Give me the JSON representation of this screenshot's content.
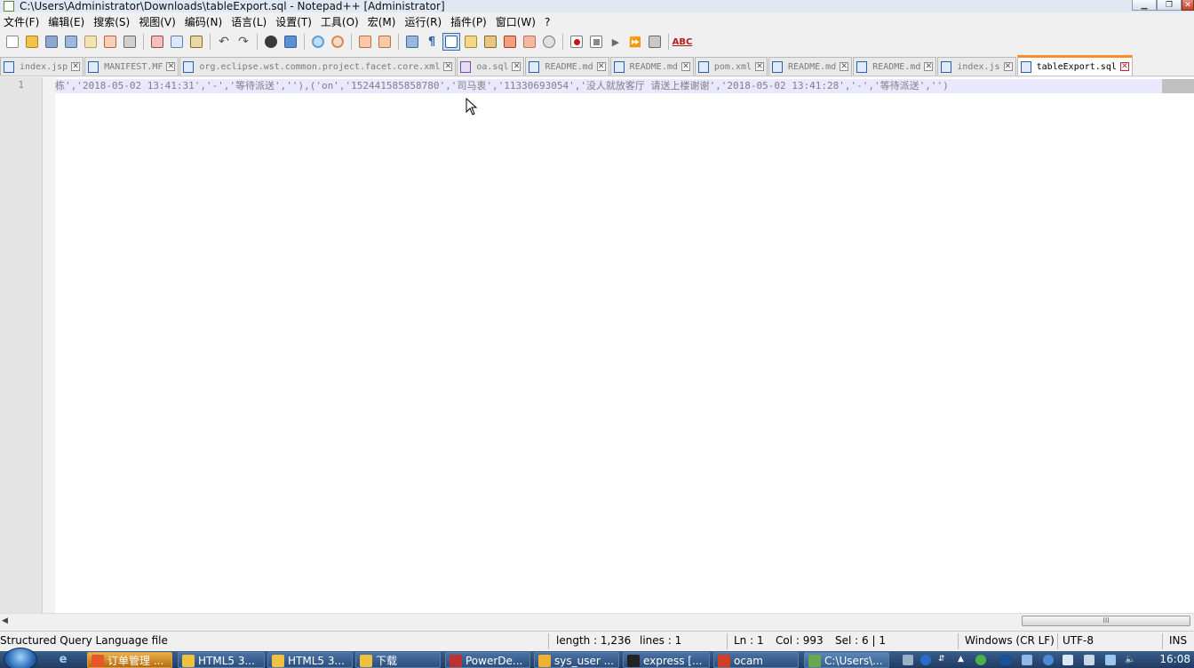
{
  "window": {
    "title": "C:\\Users\\Administrator\\Downloads\\tableExport.sql - Notepad++ [Administrator]"
  },
  "menu": [
    "文件(F)",
    "编辑(E)",
    "搜索(S)",
    "视图(V)",
    "编码(N)",
    "语言(L)",
    "设置(T)",
    "工具(O)",
    "宏(M)",
    "运行(R)",
    "插件(P)",
    "窗口(W)",
    "?"
  ],
  "toolbar": {
    "icons": [
      "new-file-icon",
      "open-file-icon",
      "save-icon",
      "save-all-icon",
      "close-icon",
      "close-all-icon",
      "print-icon",
      "cut-icon",
      "copy-icon",
      "paste-icon",
      "undo-icon",
      "redo-icon",
      "find-icon",
      "replace-icon",
      "zoom-in-icon",
      "zoom-out-icon",
      "sync-vertical-icon",
      "sync-horizontal-icon",
      "word-wrap-icon",
      "show-all-chars-icon",
      "indent-guide-icon",
      "user-language-icon",
      "doc-map-icon",
      "function-list-icon",
      "folder-workspace-icon",
      "monitor-icon",
      "record-macro-icon",
      "stop-record-icon",
      "play-macro-icon",
      "run-macro-multiple-icon",
      "save-macro-icon",
      "spell-check-icon"
    ],
    "spellcheck_label": "ABC"
  },
  "tabs": [
    {
      "label": "index.jsp",
      "active": false
    },
    {
      "label": "MANIFEST.MF",
      "active": false
    },
    {
      "label": "org.eclipse.wst.common.project.facet.core.xml",
      "active": false
    },
    {
      "label": "oa.sql",
      "active": false,
      "purple": true
    },
    {
      "label": "README.md",
      "active": false
    },
    {
      "label": "README.md",
      "active": false
    },
    {
      "label": "pom.xml",
      "active": false
    },
    {
      "label": "README.md",
      "active": false
    },
    {
      "label": "README.md",
      "active": false
    },
    {
      "label": "index.js",
      "active": false
    },
    {
      "label": "tableExport.sql",
      "active": true
    }
  ],
  "editor": {
    "line_number": "1",
    "line_text": "栋','2018-05-02 13:41:31','-','等待派送',''),('on','152441585858780','司马衷','11330693054','没人就放客厅 请送上楼谢谢','2018-05-02 13:41:28','-','等待派送','')"
  },
  "status": {
    "file_type": "Structured Query Language file",
    "length": "length : 1,236",
    "lines": "lines : 1",
    "ln": "Ln : 1",
    "col": "Col : 993",
    "sel": "Sel : 6 | 1",
    "eol": "Windows (CR LF)",
    "encoding": "UTF-8",
    "mode": "INS"
  },
  "taskbar": {
    "items": [
      {
        "label": "订单管理 ...",
        "active": true,
        "color": "#e8552a"
      },
      {
        "label": "HTML5 3...",
        "active": false,
        "color": "#f0c040"
      },
      {
        "label": "HTML5 3...",
        "active": false,
        "color": "#f0c040"
      },
      {
        "label": "下载",
        "active": false,
        "color": "#f0c040"
      },
      {
        "label": "PowerDe...",
        "active": false,
        "color": "#c03030"
      },
      {
        "label": "sys_user ...",
        "active": false,
        "color": "#f0b030"
      },
      {
        "label": "express [...",
        "active": false,
        "color": "#222222"
      },
      {
        "label": "ocam",
        "active": false,
        "color": "#d04020"
      },
      {
        "label": "C:\\Users\\...",
        "active": false,
        "color": "#6aa84f"
      }
    ],
    "clock": "16:08"
  }
}
